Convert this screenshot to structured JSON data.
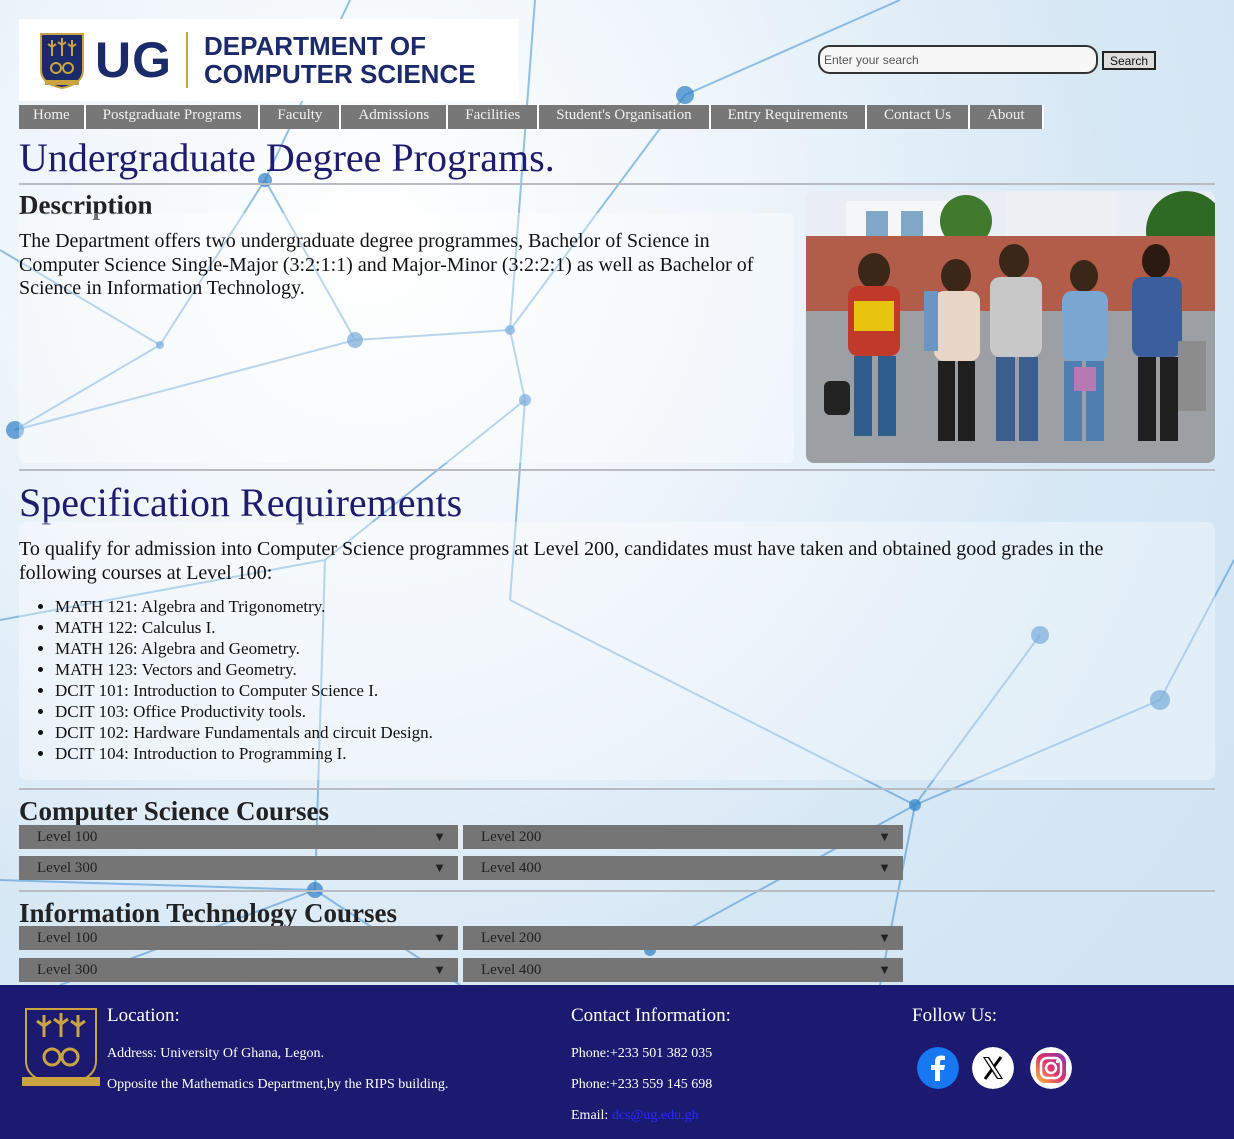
{
  "header": {
    "logo_text": "UG",
    "department_line1": "DEPARTMENT OF",
    "department_line2": "COMPUTER SCIENCE"
  },
  "search": {
    "placeholder": "Enter your search",
    "button_label": "Search"
  },
  "nav": [
    {
      "label": "Home"
    },
    {
      "label": "Postgraduate Programs"
    },
    {
      "label": "Faculty"
    },
    {
      "label": "Admissions"
    },
    {
      "label": "Facilities"
    },
    {
      "label": "Student's Organisation"
    },
    {
      "label": "Entry Requirements"
    },
    {
      "label": "Contact Us"
    },
    {
      "label": "About"
    }
  ],
  "main": {
    "title": "Undergraduate Degree Programs.",
    "description_heading": "Description",
    "description_text": "The Department offers two undergraduate degree programmes, Bachelor of Science in Computer Science Single-Major (3:2:1:1) and Major-Minor (3:2:2:1) as well as Bachelor of Science in Information Technology.",
    "spec_title": "Specification Requirements",
    "spec_intro": "To qualify for admission into Computer Science programmes at Level 200, candidates must have taken and obtained good grades in the following courses at Level 100:",
    "courses": [
      "MATH 121: Algebra and Trigonometry.",
      "MATH 122: Calculus I.",
      "MATH 126: Algebra and Geometry.",
      "MATH 123: Vectors and Geometry.",
      "DCIT 101: Introduction to Computer Science I.",
      "DCIT 103: Office Productivity tools.",
      "DCIT 102: Hardware Fundamentals and circuit Design.",
      "DCIT 104: Introduction to Programming I."
    ],
    "cs_heading": "Computer Science Courses",
    "it_heading": "Information Technology Courses",
    "levels": [
      "Level 100",
      "Level 200",
      "Level 300",
      "Level 400"
    ]
  },
  "footer": {
    "location_heading": "Location:",
    "address": "Address: University Of Ghana, Legon.",
    "directions": "Opposite the Mathematics Department,by the RIPS building.",
    "contact_heading": "Contact Information:",
    "phone1": "Phone:+233 501 382 035",
    "phone2": "Phone:+233 559 145 698",
    "email_label": "Email:",
    "email_value": "dcs@ug.edu.gh",
    "follow_heading": "Follow Us:",
    "social": [
      "facebook-icon",
      "x-icon",
      "instagram-icon"
    ]
  },
  "colors": {
    "brand_navy": "#1b1a70",
    "title_blue": "#1e1c6e",
    "nav_gray": "#777777",
    "gold": "#c9a441"
  }
}
